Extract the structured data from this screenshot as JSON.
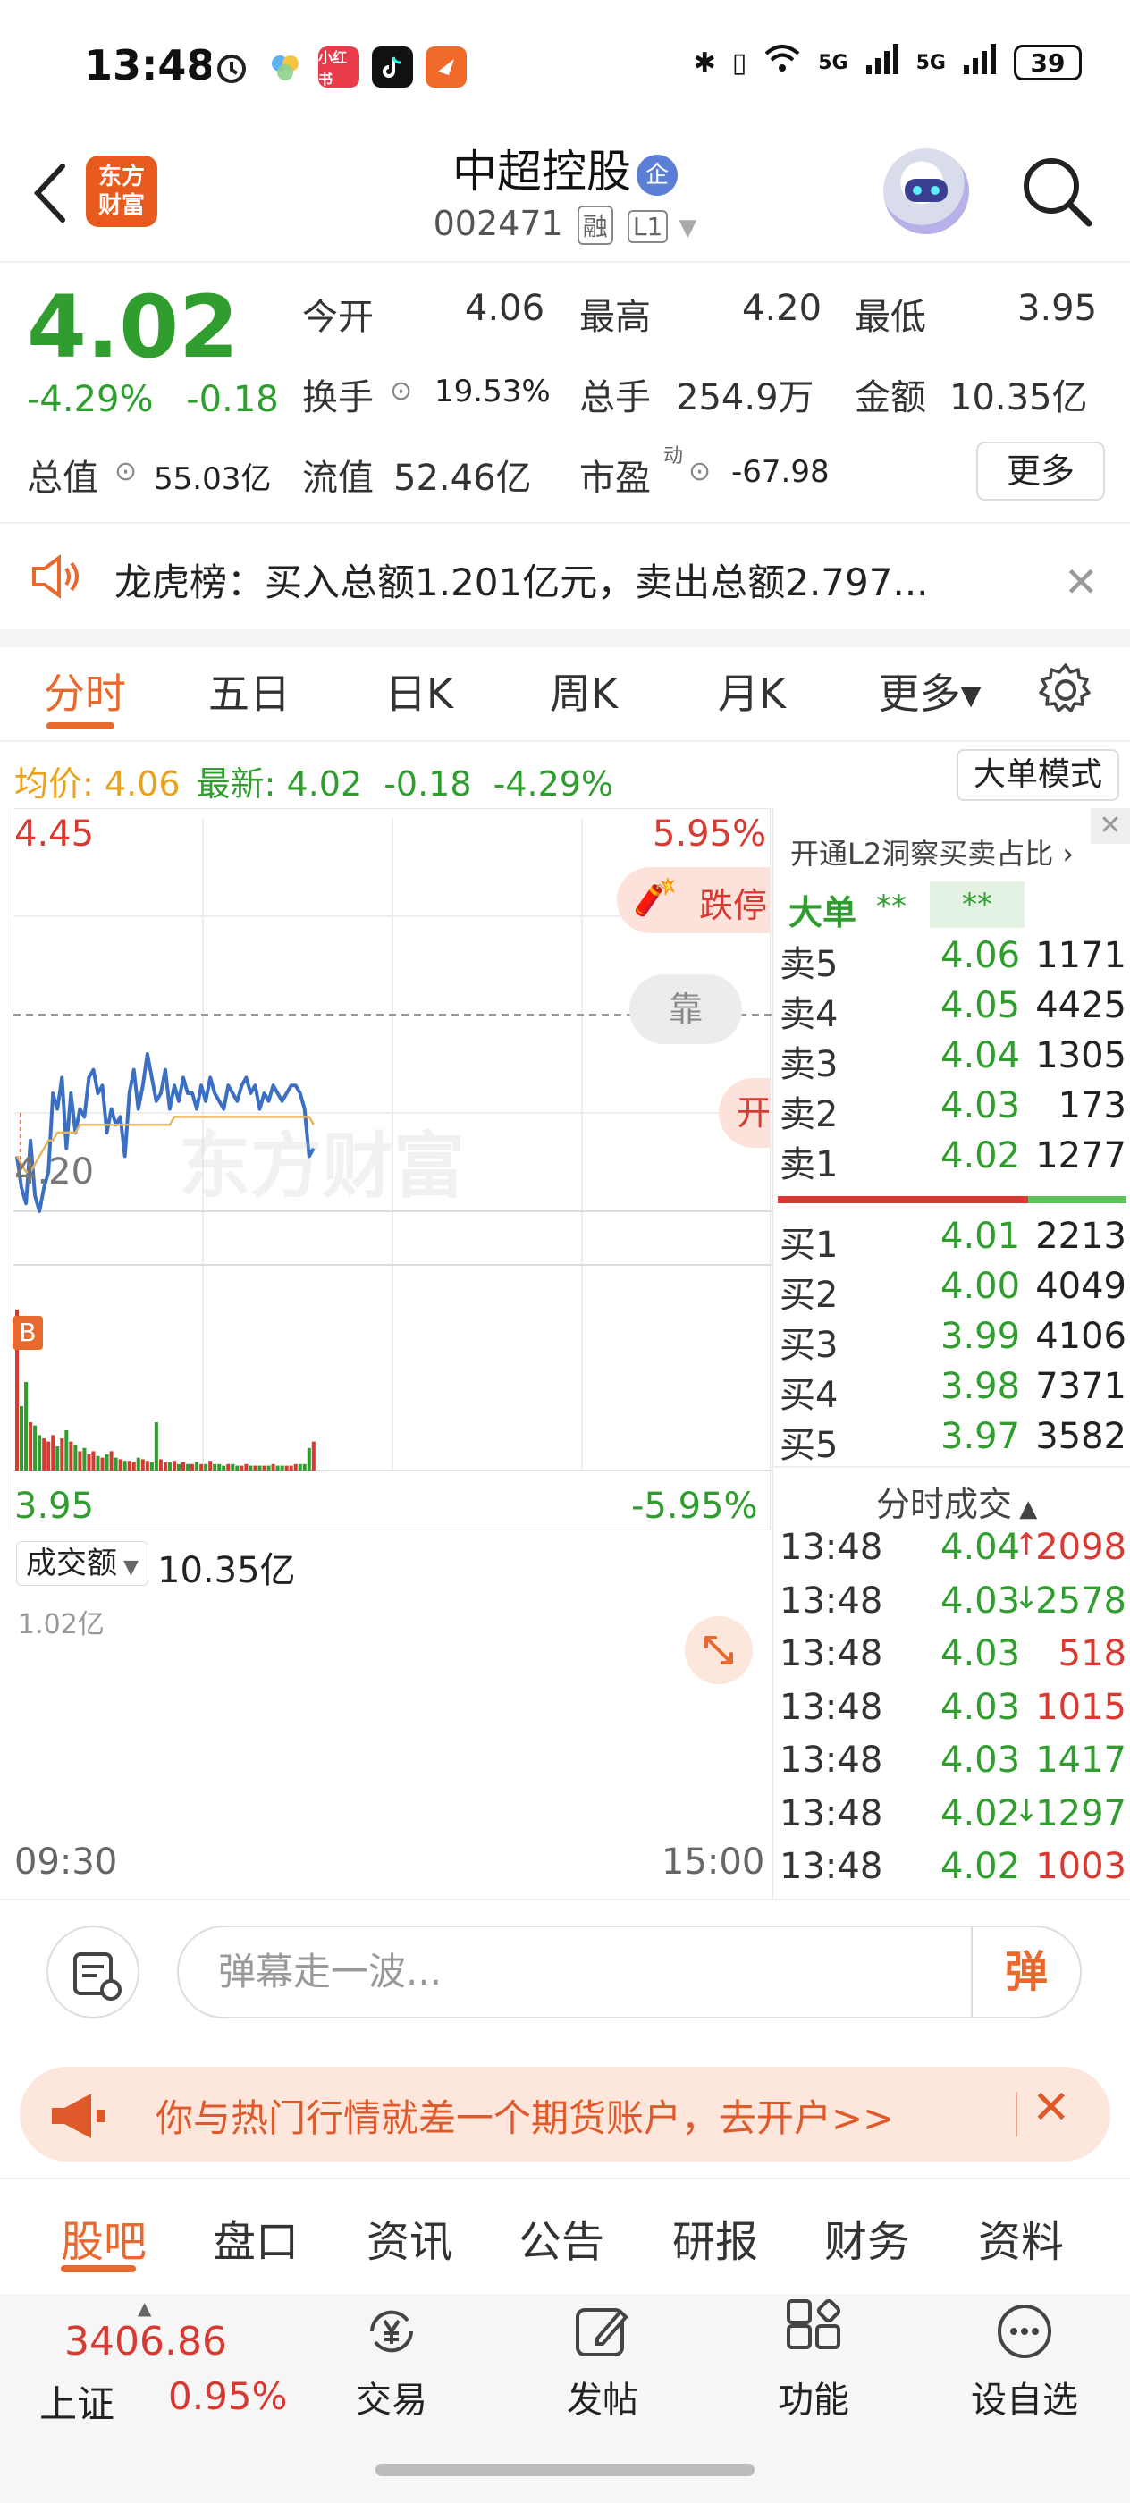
{
  "status_bar": {
    "time": "13:48",
    "apps": [
      "alarm-icon",
      "colorful-app-icon",
      "xiaohongshu-icon",
      "tiktok-icon",
      "direction-app-icon"
    ],
    "xiaohongshu_label": "小红书",
    "network_1": "5G",
    "network_2": "5G",
    "battery": "39"
  },
  "header": {
    "logo_line1": "东方",
    "logo_line2": "财富",
    "title": "中超控股",
    "title_badge": "企",
    "code": "002471",
    "tag1": "融",
    "tag2": "L1"
  },
  "quote": {
    "price": "4.02",
    "change_pct": "-4.29%",
    "change_abs": "-0.18",
    "open_label": "今开",
    "open": "4.06",
    "high_label": "最高",
    "high": "4.20",
    "low_label": "最低",
    "low": "3.95",
    "turnover_label": "换手",
    "turnover": "19.53%",
    "volume_label": "总手",
    "volume": "254.9万",
    "amount_label": "金额",
    "amount": "10.35亿",
    "mktcap_label": "总值",
    "mktcap": "55.03亿",
    "float_label": "流值",
    "float": "52.46亿",
    "pe_label": "市盈",
    "pe_sup": "动",
    "pe": "-67.98",
    "more": "更多"
  },
  "dragon_tiger": {
    "text": "龙虎榜：买入总额1.201亿元，卖出总额2.797..."
  },
  "tabs": [
    "分时",
    "五日",
    "日K",
    "周K",
    "月K",
    "更多▾"
  ],
  "avg_row": {
    "avg_label": "均价:",
    "avg": "4.06",
    "latest_label": "最新:",
    "latest": "4.02",
    "chg": "-0.18",
    "pct": "-4.29%",
    "big_mode": "大单模式"
  },
  "chart": {
    "y_top": "4.45",
    "y_top_pct": "5.95%",
    "y_mid": "4.20",
    "y_bot": "3.95",
    "y_bot_pct": "-5.95%",
    "limit_down_tag": "跌停",
    "lean_tag": "靠",
    "partial_tag": "开",
    "buy_marker": "B",
    "watermark": "东方财富",
    "vol_label": "成交额",
    "vol_value": "10.35亿",
    "vol_max": "1.02亿",
    "time_start": "09:30",
    "time_end": "15:00"
  },
  "chart_data": {
    "type": "line",
    "title": "",
    "xlabel": "",
    "ylabel": "",
    "x_range": [
      "09:30",
      "15:00"
    ],
    "ylim": [
      3.95,
      4.45
    ],
    "series": [
      {
        "values": [
          4.02,
          3.98,
          3.96,
          4.04,
          3.97,
          3.95,
          3.98,
          4.0,
          4.1,
          4.08,
          4.12,
          4.03,
          4.1,
          4.05,
          4.08,
          4.07,
          4.12,
          4.13,
          4.1,
          4.11,
          4.05,
          4.08,
          4.06,
          4.07,
          4.02,
          4.1,
          4.13,
          4.08,
          4.11,
          4.15,
          4.12,
          4.09,
          4.1,
          4.13,
          4.08,
          4.11,
          4.09,
          4.12,
          4.1,
          4.1,
          4.08,
          4.11,
          4.09,
          4.12,
          4.1,
          4.09,
          4.08,
          4.11,
          4.1,
          4.09,
          4.11,
          4.12,
          4.1,
          4.11,
          4.08,
          4.1,
          4.09,
          4.11,
          4.1,
          4.09,
          4.1,
          4.11,
          4.11,
          4.1,
          4.08,
          4.02,
          4.03
        ]
      },
      {
        "values": [
          4.02,
          4.01,
          4.0,
          4.0,
          4.01,
          4.02,
          4.03,
          4.04,
          4.04,
          4.05,
          4.05,
          4.05,
          4.05,
          4.05,
          4.06,
          4.06,
          4.06,
          4.06,
          4.06,
          4.06,
          4.06,
          4.06,
          4.06,
          4.06,
          4.06,
          4.06,
          4.06,
          4.06,
          4.06,
          4.06,
          4.06,
          4.06,
          4.06,
          4.06,
          4.06,
          4.07,
          4.07,
          4.07,
          4.07,
          4.07,
          4.07,
          4.07,
          4.07,
          4.07,
          4.07,
          4.07,
          4.07,
          4.07,
          4.07,
          4.07,
          4.07,
          4.07,
          4.07,
          4.07,
          4.07,
          4.07,
          4.07,
          4.07,
          4.07,
          4.07,
          4.07,
          4.07,
          4.07,
          4.07,
          4.07,
          4.07,
          4.06
        ]
      }
    ],
    "volume": [
      100,
      40,
      55,
      30,
      28,
      22,
      20,
      18,
      22,
      15,
      20,
      25,
      18,
      16,
      12,
      14,
      10,
      12,
      9,
      8,
      10,
      12,
      8,
      7,
      6,
      6,
      5,
      8,
      7,
      6,
      5,
      30,
      7,
      5,
      5,
      6,
      4,
      5,
      4,
      4,
      5,
      4,
      4,
      6,
      4,
      4,
      3,
      4,
      4,
      3,
      3,
      4,
      3,
      3,
      3,
      3,
      3,
      4,
      3,
      3,
      3,
      3,
      4,
      4,
      4,
      14,
      18
    ]
  },
  "l2_panel": {
    "header": "开通L2洞察买卖占比 ›",
    "big_label": "大单",
    "big_val1": "**",
    "big_val2": "**",
    "asks": [
      {
        "label": "卖5",
        "price": "4.06",
        "vol": "1171"
      },
      {
        "label": "卖4",
        "price": "4.05",
        "vol": "4425"
      },
      {
        "label": "卖3",
        "price": "4.04",
        "vol": "1305"
      },
      {
        "label": "卖2",
        "price": "4.03",
        "vol": "173"
      },
      {
        "label": "卖1",
        "price": "4.02",
        "vol": "1277"
      }
    ],
    "bids": [
      {
        "label": "买1",
        "price": "4.01",
        "vol": "2213"
      },
      {
        "label": "买2",
        "price": "4.00",
        "vol": "4049"
      },
      {
        "label": "买3",
        "price": "3.99",
        "vol": "4106"
      },
      {
        "label": "买4",
        "price": "3.98",
        "vol": "7371"
      },
      {
        "label": "买5",
        "price": "3.97",
        "vol": "3582"
      }
    ],
    "trades_header": "分时成交",
    "trades": [
      {
        "time": "13:48",
        "price": "4.04",
        "arrow": "↑",
        "vol": "2098"
      },
      {
        "time": "13:48",
        "price": "4.03",
        "arrow": "↓",
        "vol": "2578"
      },
      {
        "time": "13:48",
        "price": "4.03",
        "arrow": "",
        "vol": "518"
      },
      {
        "time": "13:48",
        "price": "4.03",
        "arrow": "",
        "vol": "1015"
      },
      {
        "time": "13:48",
        "price": "4.03",
        "arrow": "",
        "vol": "1417"
      },
      {
        "time": "13:48",
        "price": "4.02",
        "arrow": "↓",
        "vol": "1297"
      },
      {
        "time": "13:48",
        "price": "4.02",
        "arrow": "",
        "vol": "1003"
      }
    ]
  },
  "comment": {
    "placeholder": "弹幕走一波...",
    "btn": "弹"
  },
  "ad": {
    "text": "你与热门行情就差一个期货账户，去开户>>"
  },
  "bottom_tabs": [
    "股吧",
    "盘口",
    "资讯",
    "公告",
    "研报",
    "财务",
    "资料"
  ],
  "bottom_nav": {
    "index_value": "3406.86",
    "index_name": "上证",
    "index_chg": "0.95%",
    "items": [
      "交易",
      "发帖",
      "功能",
      "设自选"
    ]
  }
}
